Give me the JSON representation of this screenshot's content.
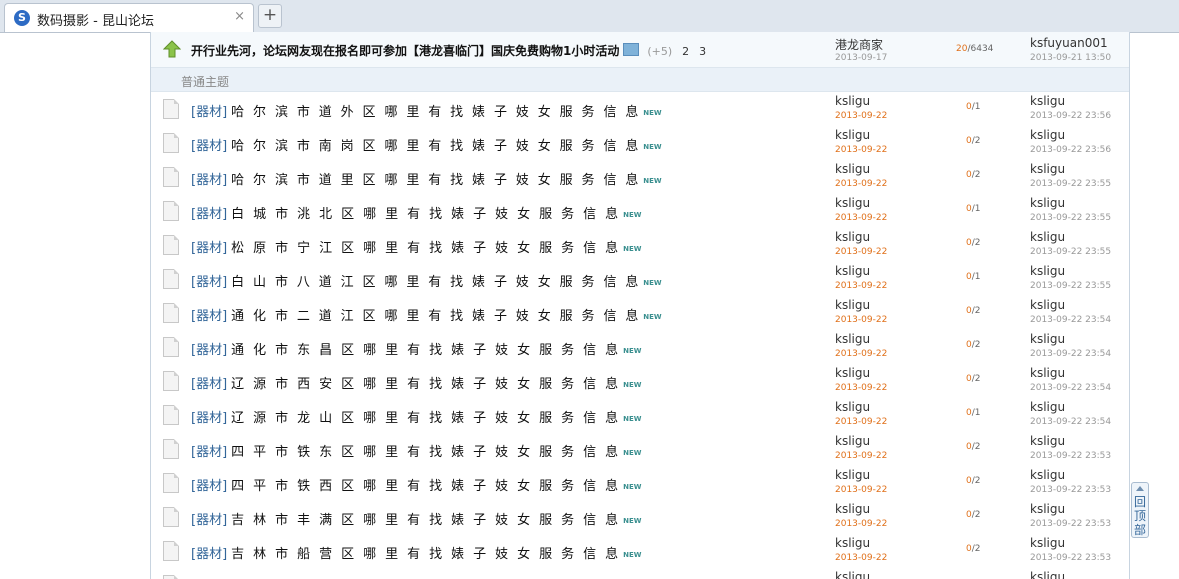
{
  "browser": {
    "tab_logo": "S",
    "tab_title": "数码摄影 - 昆山论坛",
    "close_glyph": "×",
    "newtab_glyph": "+",
    "icons": [
      "site-logo-icon",
      "close-icon",
      "plus-icon"
    ]
  },
  "sticky": {
    "icon": "up-arrow-icon",
    "title": "开行业先河，论坛网友现在报名即可参加【港龙喜临门】国庆免费购物1小时活动",
    "plus": "(+5)",
    "pages": [
      "2",
      "3"
    ],
    "author": "港龙商家",
    "author_date": "2013-09-17",
    "replies": "20",
    "views": "/6434",
    "last_user": "ksfuyuan001",
    "last_date": "2013-09-21 13:50"
  },
  "section": {
    "label": "普通主题"
  },
  "threads": [
    {
      "cat": "[器材]",
      "title": "哈尔滨市道外区哪里有找婊子妓女服务信息",
      "new": "NEW",
      "author": "ksligu",
      "date": "2013-09-22",
      "replies": "0",
      "views": "/1",
      "last": "ksligu",
      "ldate": "2013-09-22 23:56"
    },
    {
      "cat": "[器材]",
      "title": "哈尔滨市南岗区哪里有找婊子妓女服务信息",
      "new": "NEW",
      "author": "ksligu",
      "date": "2013-09-22",
      "replies": "0",
      "views": "/2",
      "last": "ksligu",
      "ldate": "2013-09-22 23:56"
    },
    {
      "cat": "[器材]",
      "title": "哈尔滨市道里区哪里有找婊子妓女服务信息",
      "new": "NEW",
      "author": "ksligu",
      "date": "2013-09-22",
      "replies": "0",
      "views": "/2",
      "last": "ksligu",
      "ldate": "2013-09-22 23:55"
    },
    {
      "cat": "[器材]",
      "title": "白城市洮北区哪里有找婊子妓女服务信息",
      "new": "NEW",
      "author": "ksligu",
      "date": "2013-09-22",
      "replies": "0",
      "views": "/1",
      "last": "ksligu",
      "ldate": "2013-09-22 23:55"
    },
    {
      "cat": "[器材]",
      "title": "松原市宁江区哪里有找婊子妓女服务信息",
      "new": "NEW",
      "author": "ksligu",
      "date": "2013-09-22",
      "replies": "0",
      "views": "/2",
      "last": "ksligu",
      "ldate": "2013-09-22 23:55"
    },
    {
      "cat": "[器材]",
      "title": "白山市八道江区哪里有找婊子妓女服务信息",
      "new": "NEW",
      "author": "ksligu",
      "date": "2013-09-22",
      "replies": "0",
      "views": "/1",
      "last": "ksligu",
      "ldate": "2013-09-22 23:55"
    },
    {
      "cat": "[器材]",
      "title": "通化市二道江区哪里有找婊子妓女服务信息",
      "new": "NEW",
      "author": "ksligu",
      "date": "2013-09-22",
      "replies": "0",
      "views": "/2",
      "last": "ksligu",
      "ldate": "2013-09-22 23:54"
    },
    {
      "cat": "[器材]",
      "title": "通化市东昌区哪里有找婊子妓女服务信息",
      "new": "NEW",
      "author": "ksligu",
      "date": "2013-09-22",
      "replies": "0",
      "views": "/2",
      "last": "ksligu",
      "ldate": "2013-09-22 23:54"
    },
    {
      "cat": "[器材]",
      "title": "辽源市西安区哪里有找婊子妓女服务信息",
      "new": "NEW",
      "author": "ksligu",
      "date": "2013-09-22",
      "replies": "0",
      "views": "/2",
      "last": "ksligu",
      "ldate": "2013-09-22 23:54"
    },
    {
      "cat": "[器材]",
      "title": "辽源市龙山区哪里有找婊子妓女服务信息",
      "new": "NEW",
      "author": "ksligu",
      "date": "2013-09-22",
      "replies": "0",
      "views": "/1",
      "last": "ksligu",
      "ldate": "2013-09-22 23:54"
    },
    {
      "cat": "[器材]",
      "title": "四平市铁东区哪里有找婊子妓女服务信息",
      "new": "NEW",
      "author": "ksligu",
      "date": "2013-09-22",
      "replies": "0",
      "views": "/2",
      "last": "ksligu",
      "ldate": "2013-09-22 23:53"
    },
    {
      "cat": "[器材]",
      "title": "四平市铁西区哪里有找婊子妓女服务信息",
      "new": "NEW",
      "author": "ksligu",
      "date": "2013-09-22",
      "replies": "0",
      "views": "/2",
      "last": "ksligu",
      "ldate": "2013-09-22 23:53"
    },
    {
      "cat": "[器材]",
      "title": "吉林市丰满区哪里有找婊子妓女服务信息",
      "new": "NEW",
      "author": "ksligu",
      "date": "2013-09-22",
      "replies": "0",
      "views": "/2",
      "last": "ksligu",
      "ldate": "2013-09-22 23:53"
    },
    {
      "cat": "[器材]",
      "title": "吉林市船营区哪里有找婊子妓女服务信息",
      "new": "NEW",
      "author": "ksligu",
      "date": "2013-09-22",
      "replies": "0",
      "views": "/2",
      "last": "ksligu",
      "ldate": "2013-09-22 23:53"
    },
    {
      "cat": "",
      "title": "",
      "new": "",
      "author": "ksligu",
      "date": "",
      "replies": "",
      "views": "",
      "last": "ksligu",
      "ldate": ""
    }
  ],
  "thread_icon": "document-icon",
  "backtop": {
    "label": "回顶部",
    "icon": "up-arrow-icon"
  },
  "colors": {
    "accent": "#336699",
    "orange": "#e0701a",
    "section_bg": "#eaf1f8"
  }
}
